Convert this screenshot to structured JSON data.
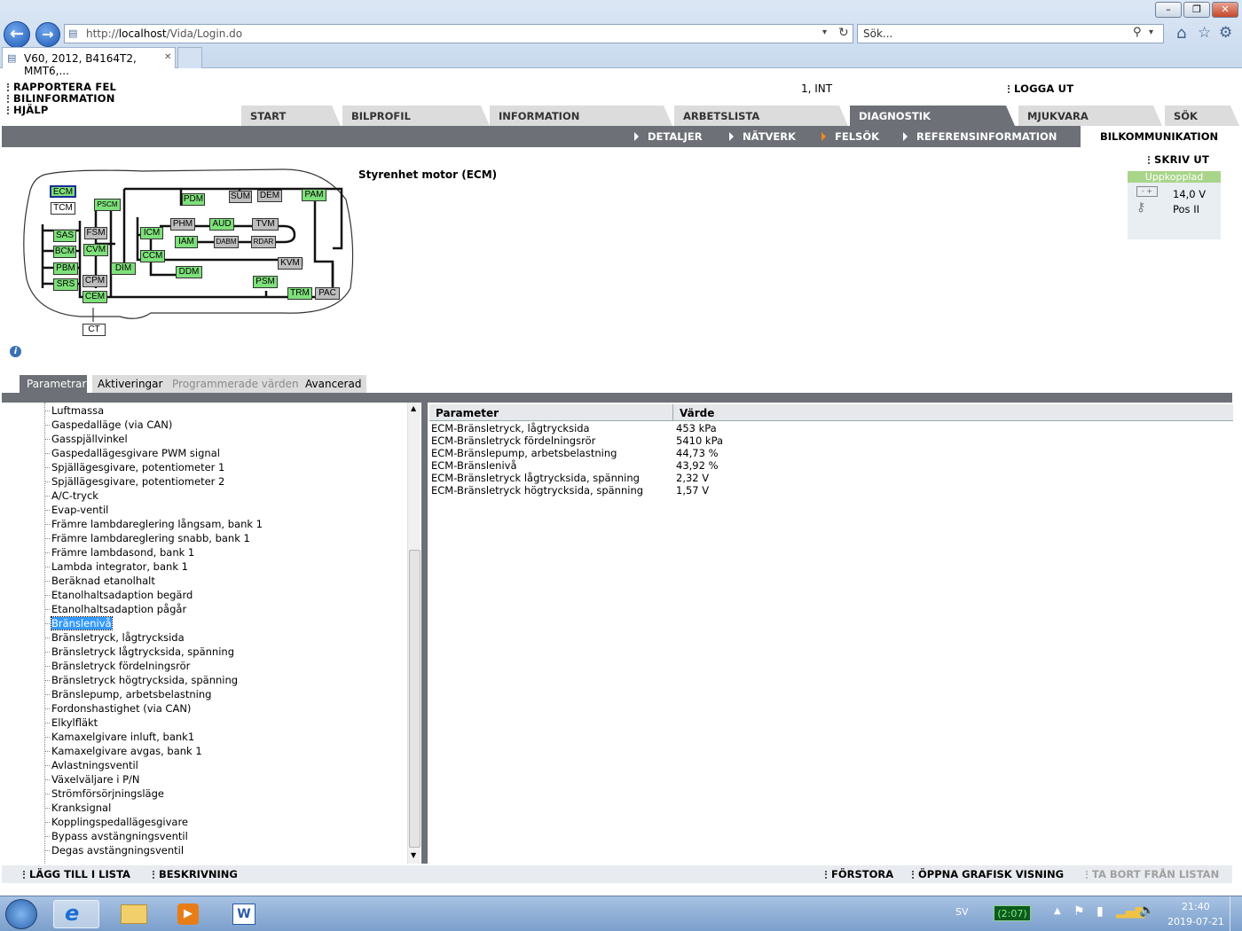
{
  "browser": {
    "url_prefix": "http://",
    "url_host": "localhost",
    "url_path": "/Vida/Login.do",
    "search_placeholder": "Sök...",
    "tab_title": "V60, 2012, B4164T2, MMT6,..."
  },
  "header": {
    "links": [
      "RAPPORTERA FEL",
      "BILINFORMATION",
      "HJÄLP"
    ],
    "user": "1, INT",
    "logout": "LOGGA UT"
  },
  "main_tabs": [
    {
      "label": "START",
      "active": false
    },
    {
      "label": "BILPROFIL",
      "active": false
    },
    {
      "label": "INFORMATION",
      "active": false
    },
    {
      "label": "ARBETSLISTA",
      "active": false
    },
    {
      "label": "DIAGNOSTIK",
      "active": true
    },
    {
      "label": "MJUKVARA",
      "active": false
    },
    {
      "label": "SÖK",
      "active": false
    }
  ],
  "sub_nav": [
    {
      "label": "DETALJER"
    },
    {
      "label": "NÄTVERK"
    },
    {
      "label": "FELSÖK"
    },
    {
      "label": "REFERENSINFORMATION"
    }
  ],
  "sub_nav_active": "BILKOMMUNIKATION",
  "print_label": "SKRIV UT",
  "ecu_title": "Styrenhet motor (ECM)",
  "status": {
    "header": "Uppkopplad",
    "voltage": "14,0 V",
    "key_position": "Pos II"
  },
  "network_nodes": [
    "ECM",
    "TCM",
    "PSCM",
    "PDM",
    "SUM",
    "DEM",
    "PAM",
    "SAS",
    "FSM",
    "ICM",
    "PHM",
    "AUD",
    "TVM",
    "BCM",
    "CVM",
    "IAM",
    "DABM",
    "RDAR",
    "PBM",
    "DIM",
    "CCM",
    "DDM",
    "KVM",
    "SRS",
    "CPM",
    "PSM",
    "TRM",
    "PAC",
    "CEM",
    "CT"
  ],
  "param_tabs": [
    {
      "label": "Parametrar",
      "state": "active"
    },
    {
      "label": "Aktiveringar",
      "state": "normal"
    },
    {
      "label": "Programmerade värden",
      "state": "disabled"
    },
    {
      "label": "Avancerad",
      "state": "normal"
    }
  ],
  "param_list": [
    "Luftmassa",
    "Gaspedalläge (via CAN)",
    "Gasspjällvinkel",
    "Gaspedallägesgivare PWM signal",
    "Spjällägesgivare, potentiometer 1",
    "Spjällägesgivare, potentiometer 2",
    "A/C-tryck",
    "Evap-ventil",
    "Främre lambdareglering långsam, bank 1",
    "Främre lambdareglering snabb, bank 1",
    "Främre lambdasond, bank 1",
    "Lambda integrator, bank 1",
    "Beräknad etanolhalt",
    "Etanolhaltsadaption begärd",
    "Etanolhaltsadaption pågår",
    "Bränslenivå",
    "Bränsletryck, lågtrycksida",
    "Bränsletryck lågtrycksida, spänning",
    "Bränsletryck fördelningsrör",
    "Bränsletryck högtrycksida, spänning",
    "Bränslepump, arbetsbelastning",
    "Fordonshastighet (via CAN)",
    "Elkylfläkt",
    "Kamaxelgivare inluft, bank1",
    "Kamaxelgivare avgas, bank 1",
    "Avlastningsventil",
    "Växelväljare i P/N",
    "Strömförsörjningsläge",
    "Kranksignal",
    "Kopplingspedallägesgivare",
    "Bypass avstängningsventil",
    "Degas avstängningsventil"
  ],
  "selected_param": "Bränslenivå",
  "table": {
    "headers": [
      "Parameter",
      "Värde"
    ],
    "rows": [
      [
        "ECM-Bränsletryck, lågtrycksida",
        "453 kPa"
      ],
      [
        "ECM-Bränsletryck fördelningsrör",
        "5410 kPa"
      ],
      [
        "ECM-Bränslepump, arbetsbelastning",
        "44,73 %"
      ],
      [
        "ECM-Bränslenivå",
        "43,92 %"
      ],
      [
        "ECM-Bränsletryck lågtrycksida, spänning",
        "2,32 V"
      ],
      [
        "ECM-Bränsletryck högtrycksida, spänning",
        "1,57 V"
      ]
    ]
  },
  "bottom_actions": {
    "add_to_list": "LÄGG TILL I LISTA",
    "description": "BESKRIVNING",
    "enlarge": "FÖRSTORA",
    "open_graphic": "ÖPPNA GRAFISK VISNING",
    "remove_from_list": "TA BORT FRÅN LISTAN"
  },
  "taskbar": {
    "language": "SV",
    "battery": "(2:07)",
    "time": "21:40",
    "date": "2019-07-21"
  }
}
